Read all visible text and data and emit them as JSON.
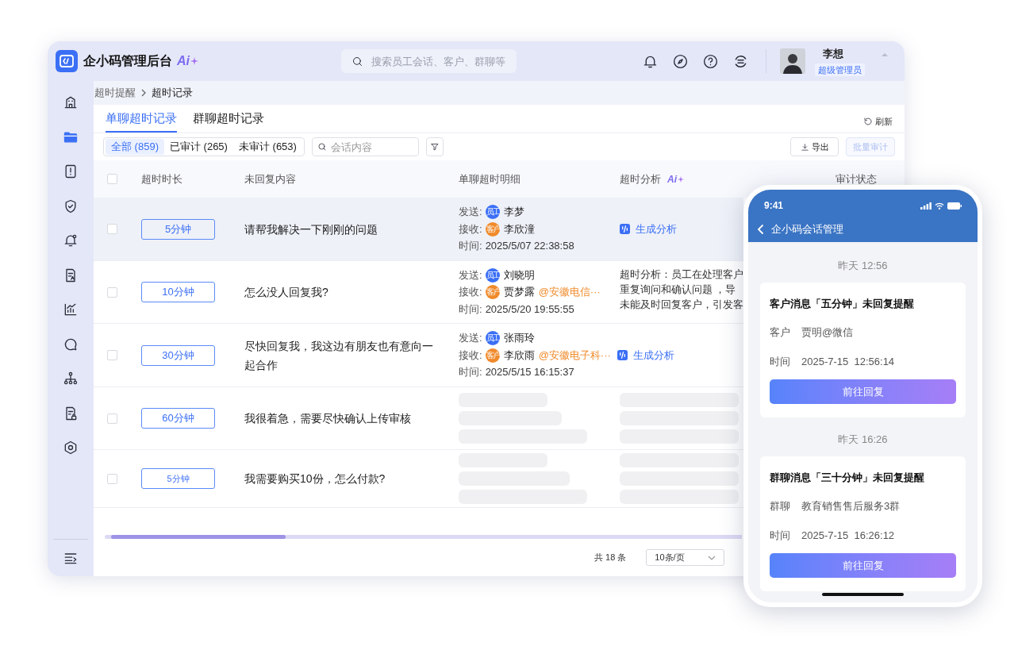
{
  "app": {
    "title": "企小码管理后台",
    "ai_badge": "Ai"
  },
  "search": {
    "placeholder": "搜索员工会话、客户、群聊等"
  },
  "user": {
    "name": "李想",
    "role": "超级管理员"
  },
  "sidebar": {
    "items": [
      {
        "selected": false
      },
      {
        "selected": true
      },
      {
        "selected": false
      },
      {
        "selected": false
      },
      {
        "selected": false
      },
      {
        "selected": false
      },
      {
        "selected": false
      },
      {
        "selected": false
      },
      {
        "selected": false
      },
      {
        "selected": false
      },
      {
        "selected": false
      }
    ]
  },
  "breadcrumb": [
    "超时提醒",
    "超时记录"
  ],
  "tabs": [
    {
      "label": "单聊超时记录",
      "selected": true
    },
    {
      "label": "群聊超时记录",
      "selected": false
    }
  ],
  "refresh": "刷新",
  "filters": [
    {
      "label": "全部 (859)",
      "selected": true
    },
    {
      "label": "已审计 (265)",
      "selected": false
    },
    {
      "label": "未审计 (653)",
      "selected": false
    }
  ],
  "content_search": {
    "placeholder": "会话内容"
  },
  "export": "导出",
  "batch_audit": {
    "label": "批量审计",
    "disabled": true
  },
  "table": {
    "header_checkbox": {
      "checked": false
    },
    "columns": [
      {
        "label": "超时时长"
      },
      {
        "label": "未回复内容"
      },
      {
        "label": "单聊超时明细"
      },
      {
        "label": "超时分析",
        "badge": "Ai"
      },
      {
        "label": "审计状态"
      }
    ],
    "rows": [
      {
        "selected": true,
        "duration": "5分钟",
        "content": "请帮我解决一下刚刚的问题",
        "loaded": true,
        "send_label": "发送:",
        "sender": {
          "tag": "员工",
          "name": "李梦"
        },
        "recv_label": "接收:",
        "receiver": {
          "tag": "客户",
          "name": "李欣潼"
        },
        "time_label": "时间:",
        "time": "2025/5/07 22:38:58",
        "analysis": {
          "kind": "action",
          "label": "生成分析"
        }
      },
      {
        "selected": false,
        "duration": "10分钟",
        "content": "怎么没人回复我?",
        "loaded": true,
        "send_label": "发送:",
        "sender": {
          "tag": "员工",
          "name": "刘晓明"
        },
        "recv_label": "接收:",
        "receiver": {
          "tag": "客户",
          "name": "贾梦露",
          "org": "@安徽电信···"
        },
        "time_label": "时间:",
        "time": "2025/5/20 19:55:55",
        "analysis": {
          "kind": "text",
          "lines": [
            "超时分析：员工在处理客户",
            "重复询问和确认问题 ，导",
            "未能及时回复客户，引发客"
          ]
        }
      },
      {
        "selected": false,
        "duration": "30分钟",
        "content": "尽快回复我，我这边有朋友也有意向一起合作",
        "loaded": true,
        "send_label": "发送:",
        "sender": {
          "tag": "员工",
          "name": "张雨玲"
        },
        "recv_label": "接收:",
        "receiver": {
          "tag": "客户",
          "name": "李欣雨",
          "org": "@安徽电子科···"
        },
        "time_label": "时间:",
        "time": "2025/5/15 16:15:37",
        "analysis": {
          "kind": "action",
          "label": "生成分析"
        }
      },
      {
        "selected": false,
        "duration": "60分钟",
        "content": "我很着急，需要尽快确认上传审核",
        "loaded": false
      },
      {
        "selected": false,
        "duration": "5分钟",
        "content": "我需要购买10份，怎么付款?",
        "loaded": false
      }
    ]
  },
  "pagination": {
    "total": "共 18 条",
    "page_size": "10条/页"
  },
  "phone": {
    "time": "9:41",
    "title": "企小码会话管理",
    "messages": [
      {
        "time": "昨天 12:56",
        "title": "客户消息「五分钟」未回复提醒",
        "fields": [
          {
            "label": "客户",
            "value": "贾明@微信"
          },
          {
            "label": "时间",
            "value": "2025-7-15  12:56:14"
          }
        ],
        "button": "前往回复"
      },
      {
        "time": "昨天 16:26",
        "title": "群聊消息「三十分钟」未回复提醒",
        "fields": [
          {
            "label": "群聊",
            "value": "教育销售售后服务3群"
          },
          {
            "label": "时间",
            "value": "2025-7-15  16:26:12"
          }
        ],
        "button": "前往回复"
      }
    ]
  }
}
